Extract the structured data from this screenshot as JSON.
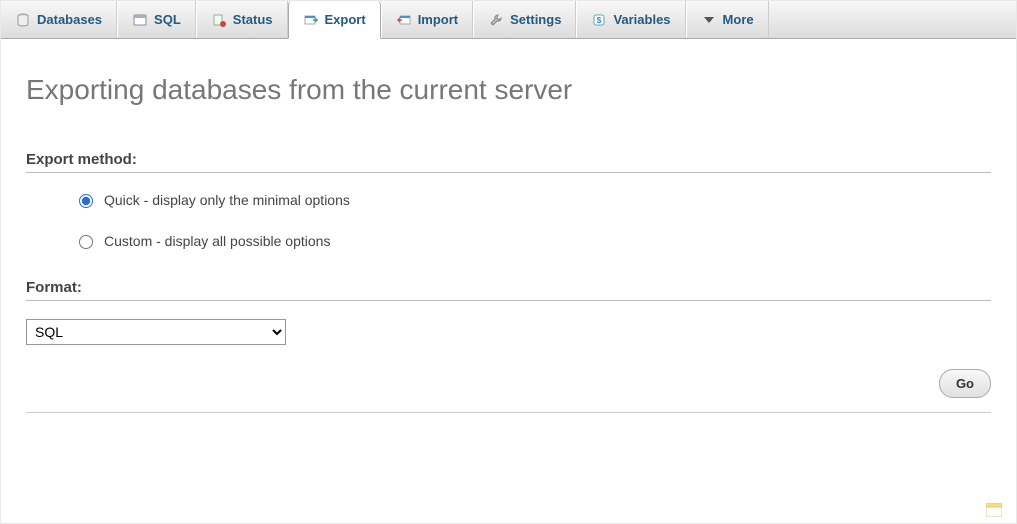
{
  "tabs": {
    "databases": "Databases",
    "sql": "SQL",
    "status": "Status",
    "export": "Export",
    "import": "Import",
    "settings": "Settings",
    "variables": "Variables",
    "more": "More"
  },
  "page": {
    "title": "Exporting databases from the current server"
  },
  "export_method": {
    "label": "Export method:",
    "quick": "Quick - display only the minimal options",
    "custom": "Custom - display all possible options",
    "selected": "quick"
  },
  "format": {
    "label": "Format:",
    "selected": "SQL"
  },
  "buttons": {
    "go": "Go"
  }
}
